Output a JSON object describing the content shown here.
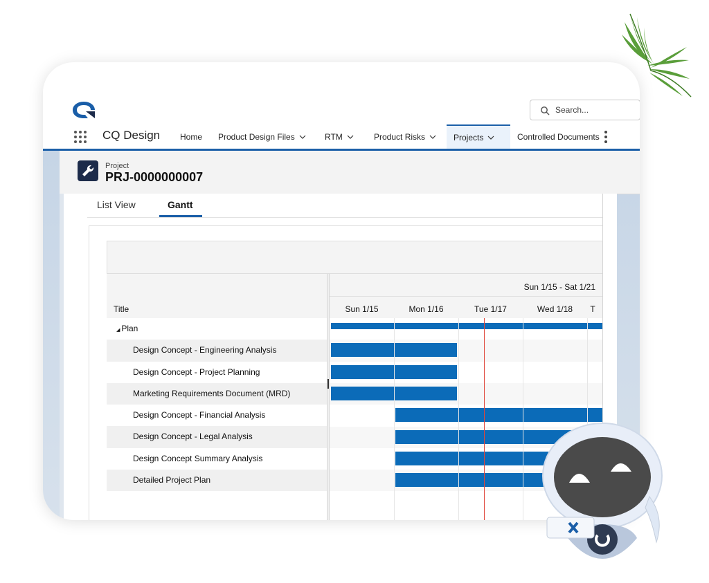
{
  "header": {
    "search_placeholder": "Search...",
    "app_name": "CQ Design",
    "nav_items": [
      {
        "label": "Home",
        "has_dropdown": false,
        "active": false
      },
      {
        "label": "Product Design Files",
        "has_dropdown": true,
        "active": false
      },
      {
        "label": "RTM",
        "has_dropdown": true,
        "active": false
      },
      {
        "label": "Product Risks",
        "has_dropdown": true,
        "active": false
      },
      {
        "label": "Projects",
        "has_dropdown": true,
        "active": true
      },
      {
        "label": "Controlled Documents",
        "has_dropdown": false,
        "active": false
      }
    ]
  },
  "record": {
    "object_label": "Project",
    "name": "PRJ-0000000007",
    "icon": "wrench-icon"
  },
  "tabs": [
    {
      "label": "List View",
      "active": false
    },
    {
      "label": "Gantt",
      "active": true
    }
  ],
  "gantt": {
    "title_header": "Title",
    "week_range": "Sun 1/15 - Sat 1/21",
    "days": [
      "Sun 1/15",
      "Mon 1/16",
      "Tue 1/17",
      "Wed 1/18",
      "T"
    ],
    "rows": [
      {
        "title": "Plan",
        "group": true,
        "start": 0,
        "end": 5
      },
      {
        "title": "Design Concept - Engineering Analysis",
        "group": false,
        "start": 0,
        "end": 2
      },
      {
        "title": "Design Concept - Project Planning",
        "group": false,
        "start": 0,
        "end": 2
      },
      {
        "title": "Marketing Requirements Document (MRD)",
        "group": false,
        "start": 0,
        "end": 2
      },
      {
        "title": "Design Concept - Financial Analysis",
        "group": false,
        "start": 1,
        "end": 5
      },
      {
        "title": "Design Concept - Legal Analysis",
        "group": false,
        "start": 1,
        "end": 5
      },
      {
        "title": "Design Concept Summary Analysis",
        "group": false,
        "start": 1,
        "end": 5
      },
      {
        "title": "Detailed Project Plan",
        "group": false,
        "start": 1,
        "end": 5
      }
    ],
    "today_offset_days": 2.4,
    "colors": {
      "bar": "#0b6bb8",
      "today_line": "#e0463a",
      "accent": "#1b5fa8"
    }
  }
}
